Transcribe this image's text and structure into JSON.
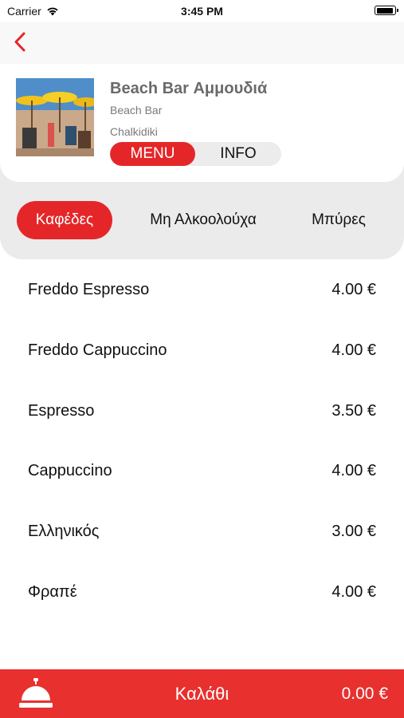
{
  "status_bar": {
    "carrier": "Carrier",
    "time": "3:45 PM"
  },
  "venue": {
    "name": "Beach Bar Αμμουδιά",
    "type": "Beach Bar",
    "location": "Chalkidiki"
  },
  "segmented": {
    "menu_label": "MENU",
    "info_label": "INFO",
    "selected": "MENU"
  },
  "categories": [
    {
      "label": "Καφέδες",
      "active": true
    },
    {
      "label": "Μη Αλκοολούχα",
      "active": false
    },
    {
      "label": "Μπύρες",
      "active": false
    }
  ],
  "menu_items": [
    {
      "name": "Freddo Espresso",
      "price": "4.00 €"
    },
    {
      "name": "Freddo Cappuccino",
      "price": "4.00 €"
    },
    {
      "name": "Espresso",
      "price": "3.50 €"
    },
    {
      "name": "Cappuccino",
      "price": "4.00 €"
    },
    {
      "name": "Ελληνικός",
      "price": "3.00 €"
    },
    {
      "name": "Φραπέ",
      "price": "4.00 €"
    }
  ],
  "cart": {
    "label": "Καλάθι",
    "total": "0.00 €"
  },
  "colors": {
    "accent": "#e52629",
    "cart_bar": "#e8302e",
    "category_band": "#ebebeb"
  },
  "icons": {
    "back": "chevron-left-icon",
    "wifi": "wifi-icon",
    "battery": "battery-icon",
    "bell": "service-bell-icon"
  }
}
